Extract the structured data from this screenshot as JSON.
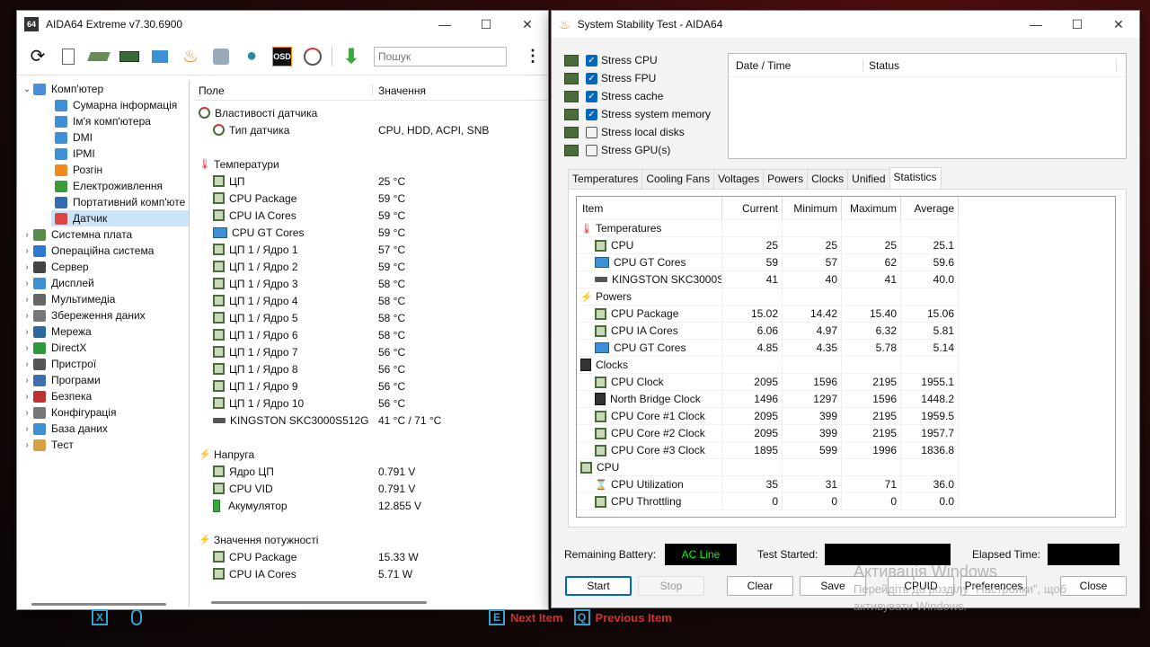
{
  "aida": {
    "title": "AIDA64 Extreme v7.30.6900",
    "icon_label": "64",
    "search_placeholder": "Пошук",
    "toolbar": [
      "refresh-icon",
      "report-icon",
      "motherboard-icon",
      "memory-icon",
      "network-icon",
      "flame-icon",
      "tools-icon",
      "user-icon",
      "osd-icon",
      "gauge-icon",
      "download-icon"
    ],
    "osd_label": "OSD",
    "tree": [
      {
        "label": "Комп'ютер",
        "level": 0,
        "arrow": "⌄",
        "icon": "#4a90d9"
      },
      {
        "label": "Сумарна інформація",
        "level": 1,
        "icon": "#3d8fd6"
      },
      {
        "label": "Ім'я комп'ютера",
        "level": 1,
        "icon": "#3d8fd6"
      },
      {
        "label": "DMI",
        "level": 1,
        "icon": "#3d8fd6"
      },
      {
        "label": "IPMI",
        "level": 1,
        "icon": "#3d8fd6"
      },
      {
        "label": "Розгін",
        "level": 1,
        "icon": "#f08a1c"
      },
      {
        "label": "Електроживлення",
        "level": 1,
        "icon": "#3a9a3a"
      },
      {
        "label": "Портативний комп'юте",
        "level": 1,
        "icon": "#2f6db0"
      },
      {
        "label": "Датчик",
        "level": 1,
        "icon": "#d44",
        "selected": true
      },
      {
        "label": "Системна плата",
        "level": 0,
        "arrow": "›",
        "icon": "#5a8a4a"
      },
      {
        "label": "Операційна система",
        "level": 0,
        "arrow": "›",
        "icon": "#2a7ad0"
      },
      {
        "label": "Сервер",
        "level": 0,
        "arrow": "›",
        "icon": "#444"
      },
      {
        "label": "Дисплей",
        "level": 0,
        "arrow": "›",
        "icon": "#3d8fd6"
      },
      {
        "label": "Мультимедіа",
        "level": 0,
        "arrow": "›",
        "icon": "#666"
      },
      {
        "label": "Збереження даних",
        "level": 0,
        "arrow": "›",
        "icon": "#777"
      },
      {
        "label": "Мережа",
        "level": 0,
        "arrow": "›",
        "icon": "#2a6aa0"
      },
      {
        "label": "DirectX",
        "level": 0,
        "arrow": "›",
        "icon": "#2a9a3a"
      },
      {
        "label": "Пристрої",
        "level": 0,
        "arrow": "›",
        "icon": "#555"
      },
      {
        "label": "Програми",
        "level": 0,
        "arrow": "›",
        "icon": "#3d6fb0"
      },
      {
        "label": "Безпека",
        "level": 0,
        "arrow": "›",
        "icon": "#c03030"
      },
      {
        "label": "Конфігурація",
        "level": 0,
        "arrow": "›",
        "icon": "#777"
      },
      {
        "label": "База даних",
        "level": 0,
        "arrow": "›",
        "icon": "#3d8fd6"
      },
      {
        "label": "Тест",
        "level": 0,
        "arrow": "›",
        "icon": "#d8a040"
      }
    ],
    "col_field": "Поле",
    "col_value": "Значення",
    "rows": [
      {
        "type": "group",
        "field": "Властивості датчика",
        "icon": "gauge"
      },
      {
        "type": "item",
        "field": "Тип датчика",
        "value": "CPU, HDD, ACPI, SNB",
        "icon": "gauge"
      },
      {
        "type": "gap"
      },
      {
        "type": "group",
        "field": "Температури",
        "icon": "thermo"
      },
      {
        "type": "item",
        "field": "ЦП",
        "value": "25 °C",
        "icon": "chip"
      },
      {
        "type": "item",
        "field": "CPU Package",
        "value": "59 °C",
        "icon": "chip"
      },
      {
        "type": "item",
        "field": "CPU IA Cores",
        "value": "59 °C",
        "icon": "chip"
      },
      {
        "type": "item",
        "field": "CPU GT Cores",
        "value": "59 °C",
        "icon": "gpu"
      },
      {
        "type": "item",
        "field": "ЦП 1 / Ядро 1",
        "value": "57 °C",
        "icon": "chip"
      },
      {
        "type": "item",
        "field": "ЦП 1 / Ядро 2",
        "value": "59 °C",
        "icon": "chip"
      },
      {
        "type": "item",
        "field": "ЦП 1 / Ядро 3",
        "value": "58 °C",
        "icon": "chip"
      },
      {
        "type": "item",
        "field": "ЦП 1 / Ядро 4",
        "value": "58 °C",
        "icon": "chip"
      },
      {
        "type": "item",
        "field": "ЦП 1 / Ядро 5",
        "value": "58 °C",
        "icon": "chip"
      },
      {
        "type": "item",
        "field": "ЦП 1 / Ядро 6",
        "value": "58 °C",
        "icon": "chip"
      },
      {
        "type": "item",
        "field": "ЦП 1 / Ядро 7",
        "value": "56 °C",
        "icon": "chip"
      },
      {
        "type": "item",
        "field": "ЦП 1 / Ядро 8",
        "value": "56 °C",
        "icon": "chip"
      },
      {
        "type": "item",
        "field": "ЦП 1 / Ядро 9",
        "value": "56 °C",
        "icon": "chip"
      },
      {
        "type": "item",
        "field": "ЦП 1 / Ядро 10",
        "value": "56 °C",
        "icon": "chip"
      },
      {
        "type": "item",
        "field": "KINGSTON SKC3000S512G",
        "value": "41 °C / 71 °C",
        "icon": "disk"
      },
      {
        "type": "gap"
      },
      {
        "type": "group",
        "field": "Напруга",
        "icon": "bolt"
      },
      {
        "type": "item",
        "field": "Ядро ЦП",
        "value": "0.791 V",
        "icon": "chip"
      },
      {
        "type": "item",
        "field": "CPU VID",
        "value": "0.791 V",
        "icon": "chip"
      },
      {
        "type": "item",
        "field": "Акумулятор",
        "value": "12.855 V",
        "icon": "battery"
      },
      {
        "type": "gap"
      },
      {
        "type": "group",
        "field": "Значення потужності",
        "icon": "bolt"
      },
      {
        "type": "item",
        "field": "CPU Package",
        "value": "15.33 W",
        "icon": "chip"
      },
      {
        "type": "item",
        "field": "CPU IA Cores",
        "value": "5.71 W",
        "icon": "chip"
      }
    ]
  },
  "sst": {
    "title": "System Stability Test - AIDA64",
    "checks": [
      {
        "label": "Stress CPU",
        "checked": true
      },
      {
        "label": "Stress FPU",
        "checked": true
      },
      {
        "label": "Stress cache",
        "checked": true
      },
      {
        "label": "Stress system memory",
        "checked": true
      },
      {
        "label": "Stress local disks",
        "checked": false
      },
      {
        "label": "Stress GPU(s)",
        "checked": false
      }
    ],
    "log_col_date": "Date / Time",
    "log_col_status": "Status",
    "tabs": [
      "Temperatures",
      "Cooling Fans",
      "Voltages",
      "Powers",
      "Clocks",
      "Unified",
      "Statistics"
    ],
    "active_tab": "Statistics",
    "stats_head": [
      "Item",
      "Current",
      "Minimum",
      "Maximum",
      "Average"
    ],
    "stats": [
      {
        "type": "group",
        "label": "Temperatures",
        "icon": "thermo"
      },
      {
        "type": "row",
        "label": "CPU",
        "icon": "chip",
        "v": [
          "25",
          "25",
          "25",
          "25.1"
        ]
      },
      {
        "type": "row",
        "label": "CPU GT Cores",
        "icon": "gpu",
        "v": [
          "59",
          "57",
          "62",
          "59.6"
        ]
      },
      {
        "type": "row",
        "label": "KINGSTON SKC3000S...",
        "icon": "disk",
        "v": [
          "41",
          "40",
          "41",
          "40.0"
        ]
      },
      {
        "type": "group",
        "label": "Powers",
        "icon": "bolt"
      },
      {
        "type": "row",
        "label": "CPU Package",
        "icon": "chip",
        "v": [
          "15.02",
          "14.42",
          "15.40",
          "15.06"
        ]
      },
      {
        "type": "row",
        "label": "CPU IA Cores",
        "icon": "chip",
        "v": [
          "6.06",
          "4.97",
          "6.32",
          "5.81"
        ]
      },
      {
        "type": "row",
        "label": "CPU GT Cores",
        "icon": "gpu",
        "v": [
          "4.85",
          "4.35",
          "5.78",
          "5.14"
        ]
      },
      {
        "type": "group",
        "label": "Clocks",
        "icon": "mem"
      },
      {
        "type": "row",
        "label": "CPU Clock",
        "icon": "chip",
        "v": [
          "2095",
          "1596",
          "2195",
          "1955.1"
        ]
      },
      {
        "type": "row",
        "label": "North Bridge Clock",
        "icon": "mem",
        "v": [
          "1496",
          "1297",
          "1596",
          "1448.2"
        ]
      },
      {
        "type": "row",
        "label": "CPU Core #1 Clock",
        "icon": "chip",
        "v": [
          "2095",
          "399",
          "2195",
          "1959.5"
        ]
      },
      {
        "type": "row",
        "label": "CPU Core #2 Clock",
        "icon": "chip",
        "v": [
          "2095",
          "399",
          "2195",
          "1957.7"
        ]
      },
      {
        "type": "row",
        "label": "CPU Core #3 Clock",
        "icon": "chip",
        "v": [
          "1895",
          "599",
          "1996",
          "1836.8"
        ]
      },
      {
        "type": "group",
        "label": "CPU",
        "icon": "chip"
      },
      {
        "type": "row",
        "label": "CPU Utilization",
        "icon": "hourglass",
        "v": [
          "35",
          "31",
          "71",
          "36.0"
        ]
      },
      {
        "type": "row",
        "label": "CPU Throttling",
        "icon": "chip",
        "v": [
          "0",
          "0",
          "0",
          "0.0"
        ]
      }
    ],
    "remaining_battery_label": "Remaining Battery:",
    "remaining_battery_value": "AC Line",
    "test_started_label": "Test Started:",
    "test_started_value": "",
    "elapsed_label": "Elapsed Time:",
    "elapsed_value": "",
    "buttons": {
      "start": "Start",
      "stop": "Stop",
      "clear": "Clear",
      "save": "Save",
      "cpuid": "CPUID",
      "preferences": "Preferences",
      "close": "Close"
    }
  },
  "watermark": {
    "line1": "Активація Windows",
    "line2": "Перейдіть до розділу \"Настройки\", щоб",
    "line3": "активувати Windows."
  },
  "footer": {
    "x_key": "X",
    "e_key": "E",
    "next": "Next Item",
    "q_key": "Q",
    "prev": "Previous Item"
  }
}
